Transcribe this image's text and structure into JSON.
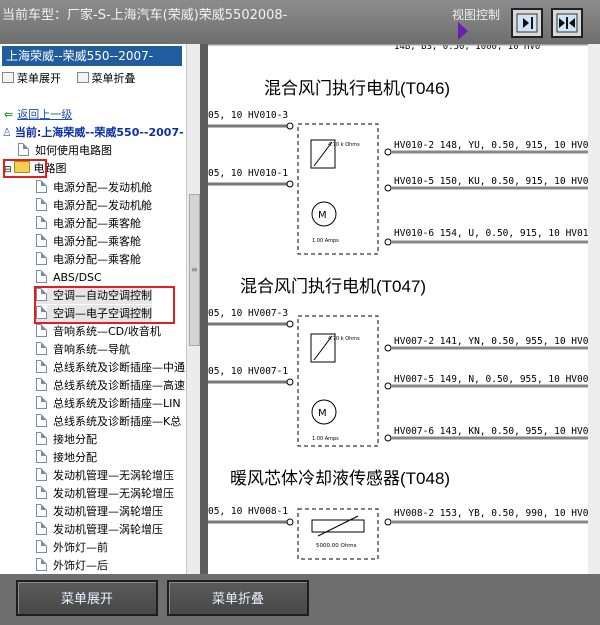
{
  "window": {
    "title": "当前车型：厂家-S-上海汽车(荣威)荣威5502008-",
    "view_control_label": "视图控制"
  },
  "sidebar": {
    "vehicle_header": "上海荣威--荣威550--2007-",
    "tools": {
      "expand_label": "菜单展开",
      "collapse_label": "菜单折叠"
    },
    "back_label": "返回上一级",
    "current_label": "当前:上海荣威--荣威550--2007-",
    "how_to_label": "如何使用电路图",
    "folder_label": "电路图",
    "items": [
      "电源分配—发动机舱",
      "电源分配—发动机舱",
      "电源分配—乘客舱",
      "电源分配—乘客舱",
      "电源分配—乘客舱",
      "ABS/DSC",
      "空调—自动空调控制",
      "空调—电子空调控制",
      "音响系统—CD/收音机",
      "音响系统—导航",
      "总线系统及诊断插座—中通",
      "总线系统及诊断插座—高速",
      "总线系统及诊断插座—LIN",
      "总线系统及诊断插座—K总",
      "接地分配",
      "接地分配",
      "发动机管理—无涡轮增压",
      "发动机管理—无涡轮增压",
      "发动机管理—涡轮增压",
      "发动机管理—涡轮增压",
      "外饰灯—前",
      "外饰灯—后"
    ]
  },
  "diagram": {
    "top_partial": "14B, BS, 0.50, 1000, 10 HV0",
    "sections": [
      {
        "title": "混合风门执行电机(T046)",
        "left_wires": [
          "05, 10 HV010-3",
          "05, 10 HV010-1"
        ],
        "right_wires": [
          "HV010-2 148, YU, 0.50, 915, 10 HV01",
          "HV010-5 150, KU, 0.50, 915, 10 HV01",
          "HV010-6 154, U, 0.50, 915, 10 HV01"
        ],
        "resistor_label": "4.70 k Ohms",
        "motor_label": "1.00 Amps"
      },
      {
        "title": "混合风门执行电机(T047)",
        "left_wires": [
          "05, 10 HV007-3",
          "05, 10 HV007-1"
        ],
        "right_wires": [
          "HV007-2 141, YN, 0.50, 955, 10 HV00",
          "HV007-5 149, N, 0.50, 955, 10 HV00",
          "HV007-6 143, KN, 0.50, 955, 10 HV00"
        ],
        "resistor_label": "4.70 k Ohms",
        "motor_label": "1.00 Amps"
      },
      {
        "title": "暖风芯体冷却液传感器(T048)",
        "left_wires": [
          "05, 10 HV008-1"
        ],
        "right_wires": [
          "HV008-2 153, YB, 0.50, 990, 10 HV00"
        ],
        "resistor_label": "5000.00 Ohms",
        "motor_label": ""
      }
    ]
  },
  "bottom": {
    "expand_label": "菜单展开",
    "collapse_label": "菜单折叠"
  }
}
